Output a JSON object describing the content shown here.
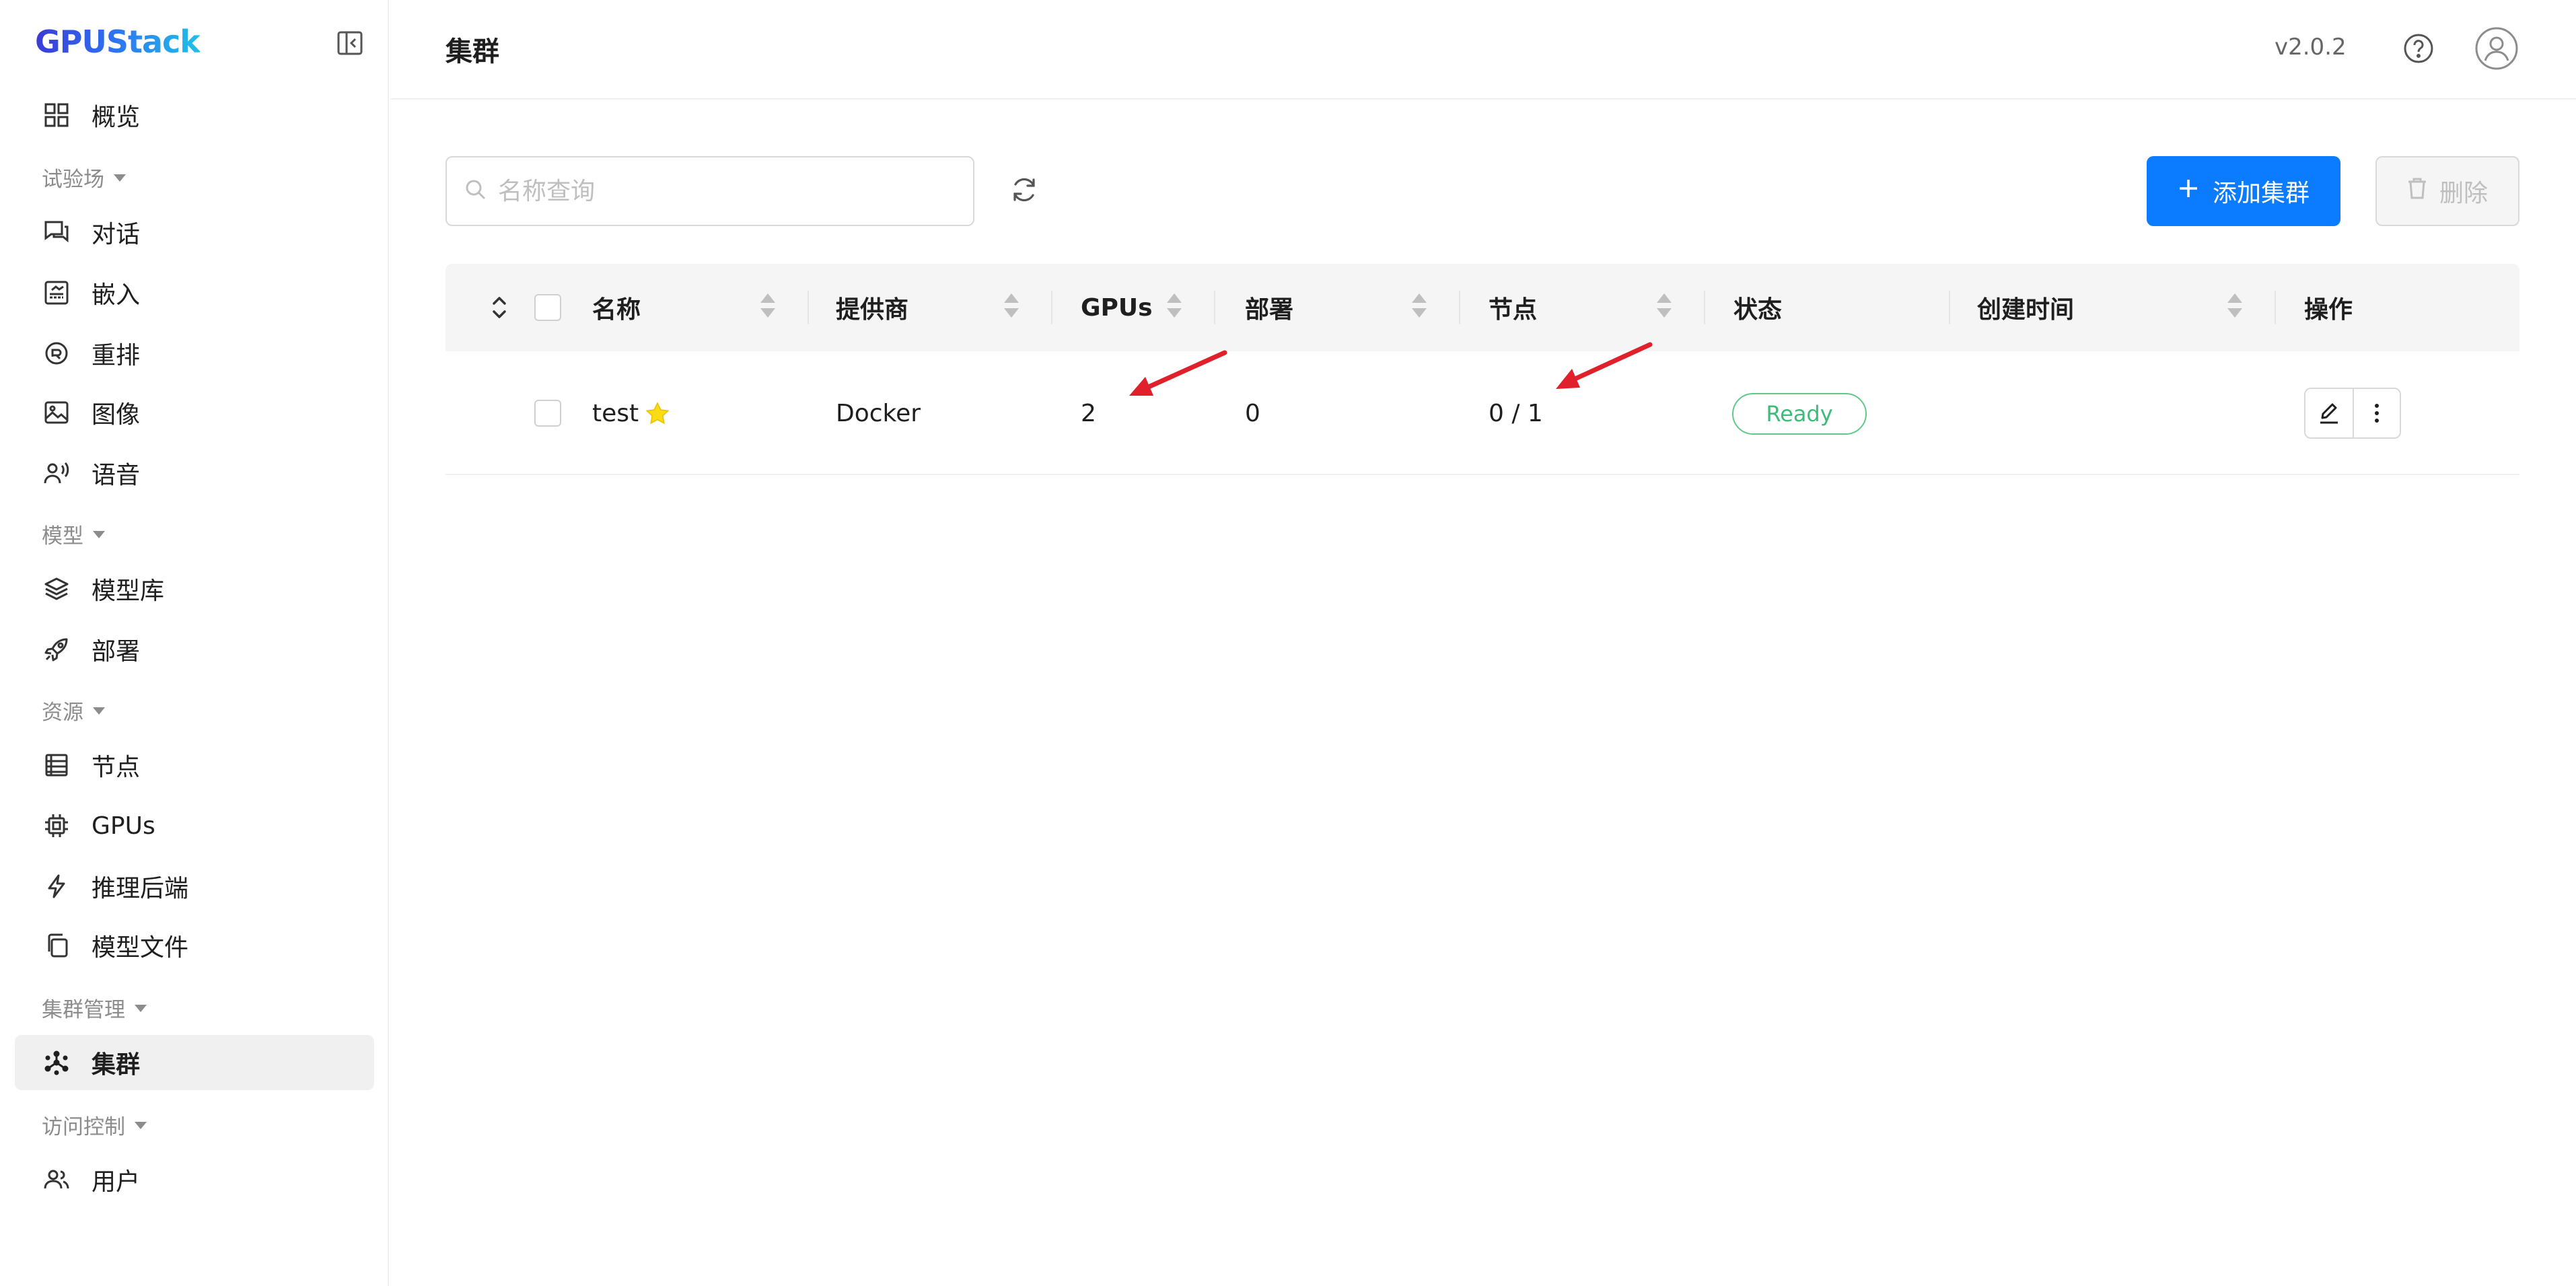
{
  "app": {
    "logo": "GPUStack",
    "version": "v2.0.2"
  },
  "sidebar": {
    "top_item": {
      "label": "概览",
      "icon": "dashboard-icon"
    },
    "groups": [
      {
        "label": "试验场",
        "items": [
          {
            "label": "对话",
            "icon": "chat-icon"
          },
          {
            "label": "嵌入",
            "icon": "embed-icon"
          },
          {
            "label": "重排",
            "icon": "rerank-icon"
          },
          {
            "label": "图像",
            "icon": "image-icon"
          },
          {
            "label": "语音",
            "icon": "audio-icon"
          }
        ]
      },
      {
        "label": "模型",
        "items": [
          {
            "label": "模型库",
            "icon": "layers-icon"
          },
          {
            "label": "部署",
            "icon": "rocket-icon"
          }
        ]
      },
      {
        "label": "资源",
        "items": [
          {
            "label": "节点",
            "icon": "server-list-icon"
          },
          {
            "label": "GPUs",
            "icon": "chip-icon"
          },
          {
            "label": "推理后端",
            "icon": "lightning-icon"
          },
          {
            "label": "模型文件",
            "icon": "files-icon"
          }
        ]
      },
      {
        "label": "集群管理",
        "items": [
          {
            "label": "集群",
            "icon": "cluster-icon",
            "active": true
          }
        ]
      },
      {
        "label": "访问控制",
        "items": [
          {
            "label": "用户",
            "icon": "users-icon"
          }
        ]
      }
    ]
  },
  "header": {
    "title": "集群"
  },
  "toolbar": {
    "search_placeholder": "名称查询",
    "add_label": "添加集群",
    "delete_label": "删除"
  },
  "table": {
    "columns": [
      "名称",
      "提供商",
      "GPUs",
      "部署",
      "节点",
      "状态",
      "创建时间",
      "操作"
    ],
    "rows": [
      {
        "name": "test",
        "starred": true,
        "provider": "Docker",
        "gpus": "2",
        "deployments": "0",
        "nodes": "0 / 1",
        "status": "Ready",
        "created": ""
      }
    ]
  },
  "colors": {
    "primary": "#0b7cff",
    "status_ready": "#3dbb7a",
    "annotation_arrow": "#e0202a"
  }
}
